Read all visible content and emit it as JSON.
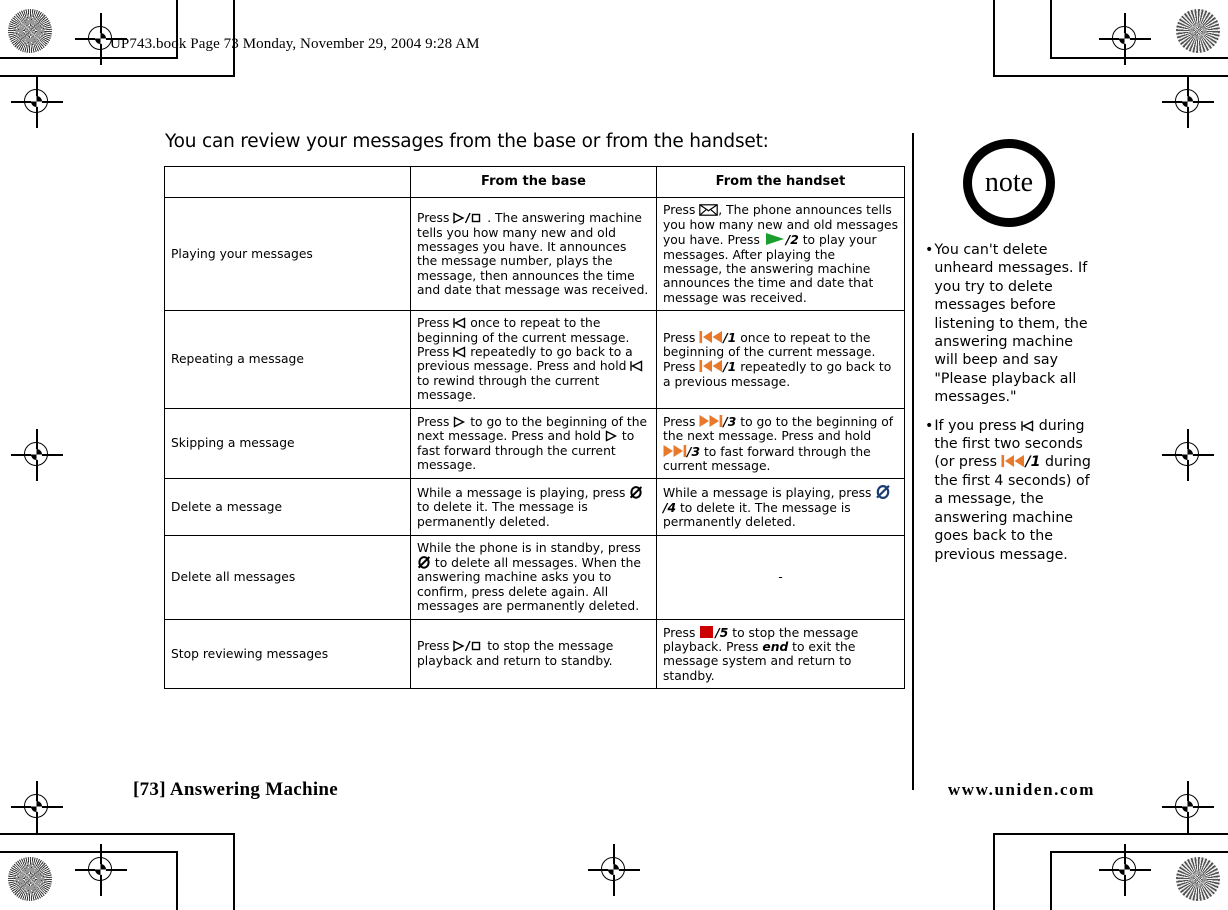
{
  "document": {
    "file_header": "UP743.book  Page 73  Monday, November 29, 2004  9:28 AM",
    "intro": "You can review your messages from the base or from the handset:",
    "footer_left": "[73] Answering Machine",
    "footer_right": "www.uniden.com"
  },
  "colors": {
    "play_green": "#1a9e2e",
    "skip_orange": "#e8792a",
    "stop_red": "#cc0000",
    "delete_blue": "#1c3d74",
    "ink": "#000000"
  },
  "table": {
    "headers": [
      "",
      "From the base",
      "From the handset"
    ],
    "rows": [
      {
        "label": "Playing your messages",
        "base": {
          "segments": [
            {
              "t": "text",
              "v": "Press "
            },
            {
              "t": "icon",
              "v": "play-stop-outline-icon"
            },
            {
              "t": "text",
              "v": " . The answering machine tells you how many new and old messages you have. It announces the message number, plays the message, then announces the time and date that message was received."
            }
          ]
        },
        "handset": {
          "segments": [
            {
              "t": "text",
              "v": "Press "
            },
            {
              "t": "icon",
              "v": "envelope-icon"
            },
            {
              "t": "text",
              "v": ", The phone announces tells you how many new and old messages you have. Press "
            },
            {
              "t": "icon",
              "v": "play-green-icon"
            },
            {
              "t": "key",
              "v": "/2"
            },
            {
              "t": "text",
              "v": " to play your messages. After playing the message, the answering machine announces the time and date that message was received."
            }
          ]
        }
      },
      {
        "label": "Repeating a message",
        "base": {
          "segments": [
            {
              "t": "text",
              "v": "Press "
            },
            {
              "t": "icon",
              "v": "rewind-outline-icon"
            },
            {
              "t": "text",
              "v": " once to repeat to the beginning of the current message. Press "
            },
            {
              "t": "icon",
              "v": "rewind-outline-icon"
            },
            {
              "t": "text",
              "v": " repeatedly to go back to a previous message. Press and hold "
            },
            {
              "t": "icon",
              "v": "rewind-outline-icon"
            },
            {
              "t": "text",
              "v": " to rewind through the current message."
            }
          ]
        },
        "handset": {
          "segments": [
            {
              "t": "text",
              "v": "Press "
            },
            {
              "t": "icon",
              "v": "rewind-orange-icon"
            },
            {
              "t": "key",
              "v": "/1"
            },
            {
              "t": "text",
              "v": " once to repeat to the beginning of the current message. Press "
            },
            {
              "t": "icon",
              "v": "rewind-orange-icon"
            },
            {
              "t": "key",
              "v": "/1"
            },
            {
              "t": "text",
              "v": " repeatedly to go back to a previous message."
            }
          ]
        }
      },
      {
        "label": "Skipping a message",
        "base": {
          "segments": [
            {
              "t": "text",
              "v": "Press "
            },
            {
              "t": "icon",
              "v": "forward-outline-icon"
            },
            {
              "t": "text",
              "v": " to go to the beginning of the next message. Press and hold "
            },
            {
              "t": "icon",
              "v": "forward-outline-icon"
            },
            {
              "t": "text",
              "v": " to fast forward through the current message."
            }
          ]
        },
        "handset": {
          "segments": [
            {
              "t": "text",
              "v": "Press "
            },
            {
              "t": "icon",
              "v": "forward-orange-icon"
            },
            {
              "t": "key",
              "v": "/3"
            },
            {
              "t": "text",
              "v": " to go to the beginning of the next message. Press and hold "
            },
            {
              "t": "icon",
              "v": "forward-orange-icon"
            },
            {
              "t": "key",
              "v": "/3"
            },
            {
              "t": "text",
              "v": " to fast forward through the current message."
            }
          ]
        }
      },
      {
        "label": "Delete a message",
        "base": {
          "segments": [
            {
              "t": "text",
              "v": "While a message is playing, press "
            },
            {
              "t": "icon",
              "v": "delete-black-icon"
            },
            {
              "t": "text",
              "v": " to delete it. The message is permanently deleted."
            }
          ]
        },
        "handset": {
          "segments": [
            {
              "t": "text",
              "v": "While a message is playing, press "
            },
            {
              "t": "icon",
              "v": "delete-blue-icon"
            },
            {
              "t": "key",
              "v": "/4"
            },
            {
              "t": "text",
              "v": " to delete it. The message is permanently deleted."
            }
          ]
        }
      },
      {
        "label": "Delete all messages",
        "base": {
          "segments": [
            {
              "t": "text",
              "v": "While the phone is in standby, press "
            },
            {
              "t": "icon",
              "v": "delete-black-icon"
            },
            {
              "t": "text",
              "v": " to delete all messages. When the answering machine asks you to confirm, press delete again. All messages are permanently deleted."
            }
          ]
        },
        "handset": {
          "segments": [
            {
              "t": "text",
              "v": "-"
            }
          ],
          "center": true
        }
      },
      {
        "label": "Stop reviewing messages",
        "base": {
          "segments": [
            {
              "t": "text",
              "v": "Press "
            },
            {
              "t": "icon",
              "v": "play-stop-outline-icon"
            },
            {
              "t": "text",
              "v": " to stop the message playback and return to standby."
            }
          ]
        },
        "handset": {
          "segments": [
            {
              "t": "text",
              "v": "Press "
            },
            {
              "t": "icon",
              "v": "stop-red-icon"
            },
            {
              "t": "key",
              "v": "/5"
            },
            {
              "t": "text",
              "v": " to stop the message playback. Press "
            },
            {
              "t": "bi",
              "v": "end"
            },
            {
              "t": "text",
              "v": " to exit the message system and return to standby."
            }
          ]
        }
      }
    ]
  },
  "note": {
    "badge": "note",
    "bullet": "•",
    "items": [
      {
        "segments": [
          {
            "t": "text",
            "v": "You can't delete unheard messages. If you try to delete messages before listening to them, the answering machine will beep and say \"Please playback all messages.\""
          }
        ]
      },
      {
        "segments": [
          {
            "t": "text",
            "v": "If you press "
          },
          {
            "t": "icon",
            "v": "rewind-outline-icon"
          },
          {
            "t": "text",
            "v": " during the first two seconds (or press "
          },
          {
            "t": "icon",
            "v": "rewind-orange-icon"
          },
          {
            "t": "key",
            "v": "/1"
          },
          {
            "t": "text",
            "v": " during the first 4 seconds) of a message, the answering machine goes back to the previous message."
          }
        ]
      }
    ]
  }
}
